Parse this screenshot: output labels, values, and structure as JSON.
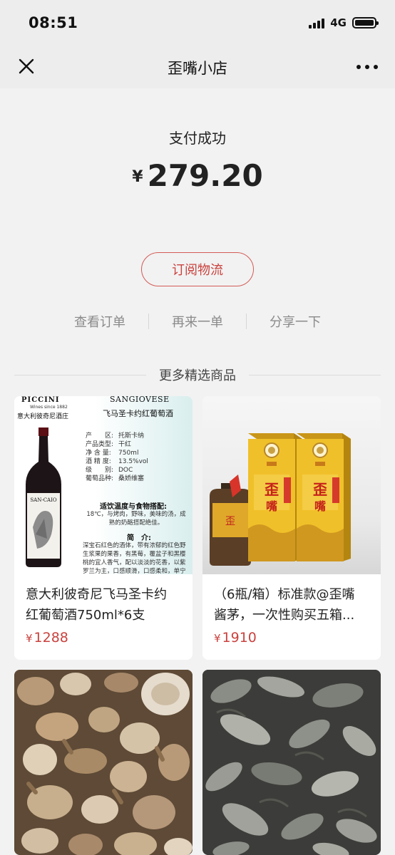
{
  "status_bar": {
    "time": "08:51",
    "network": "4G"
  },
  "nav": {
    "title": "歪嘴小店",
    "close_icon": "close-icon",
    "more_icon": "more-dots-icon"
  },
  "payment": {
    "status": "支付成功",
    "currency": "¥",
    "amount": "279.20",
    "logistics_label": "订阅物流"
  },
  "actions": [
    {
      "label": "查看订单"
    },
    {
      "label": "再来一单"
    },
    {
      "label": "分享一下"
    }
  ],
  "recommend": {
    "title": "更多精选商品",
    "products": [
      {
        "name_line1": "意大利彼奇尼飞马圣卡约",
        "name_line2": "红葡萄酒750ml*6支",
        "currency": "¥",
        "price": "1288",
        "image": {
          "brand": "PICCINI",
          "brand_sub": "Wines since 1882",
          "brand_cn": "意大利彼奇尼酒庄",
          "grape": "SANGIOVESE",
          "heading": "飞马圣卡约红葡萄酒",
          "bottle_label": "SAN-CAIO",
          "specs": [
            {
              "key": "产　　区:",
              "value": "托斯卡纳"
            },
            {
              "key": "产品类型:",
              "value": "干红"
            },
            {
              "key": "净 含 量:",
              "value": "750ml"
            },
            {
              "key": "酒 精 度:",
              "value": "13.5%vol"
            },
            {
              "key": "级　　别:",
              "value": "DOC"
            },
            {
              "key": "葡萄品种:",
              "value": "桑娇维塞"
            }
          ],
          "pairing_title": "适饮温度与食物搭配:",
          "pairing_text": "18℃，与烤肉，野味，美味的汤，成熟的奶酪搭配绝佳。",
          "intro_title": "简　介:",
          "intro_text": "深宝石红色的酒体，带有浓郁的红色野生浆果的果香，有黑莓，覆盆子和黑樱桃的宜人香气，配以淡淡的花香，以紫罗兰为主，口感顺滑，口感柔和，单宁无比细腻的香醇"
        }
      },
      {
        "name_line1": "（6瓶/箱）标准款@歪嘴",
        "name_line2": "酱茅，一次性购买五箱...",
        "currency": "¥",
        "price": "1910",
        "image": {
          "box_text": "王歪嘴"
        }
      },
      {
        "name_line1": "",
        "name_line2": "",
        "currency": "",
        "price": ""
      },
      {
        "name_line1": "",
        "name_line2": "",
        "currency": "",
        "price": ""
      }
    ]
  },
  "colors": {
    "accent": "#c9423e",
    "header_bg": "#ededed",
    "page_bg": "#f2f2f2"
  }
}
